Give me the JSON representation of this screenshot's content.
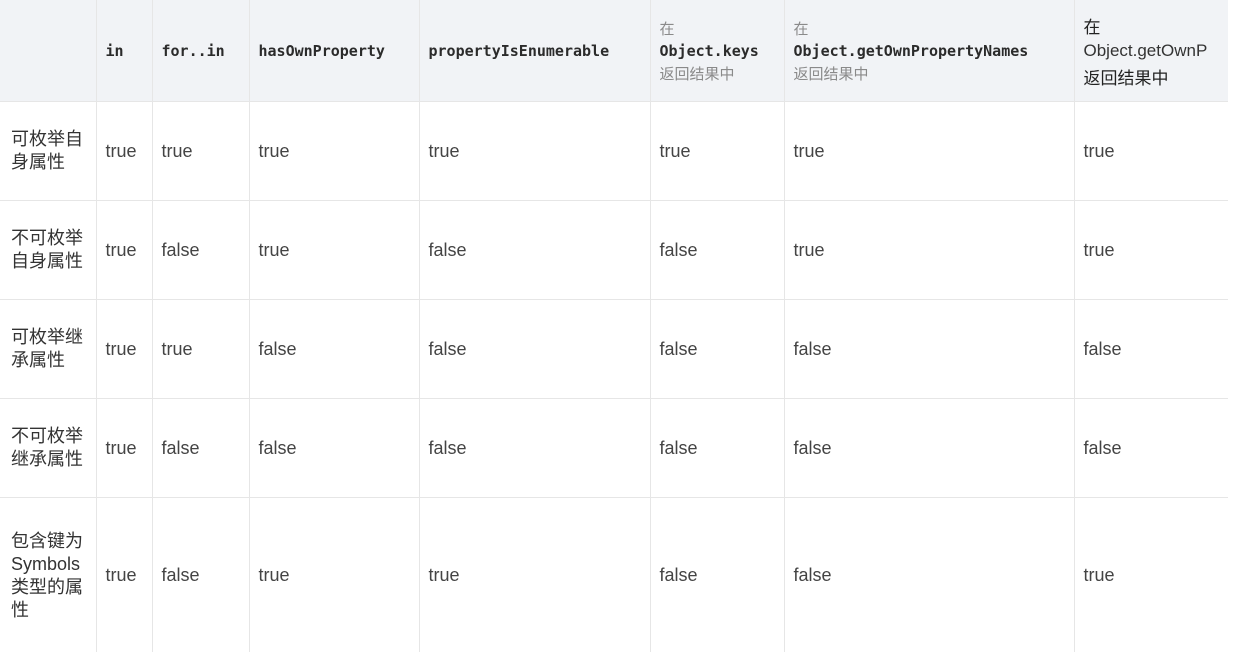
{
  "table": {
    "headers": [
      {
        "kind": "empty",
        "text": ""
      },
      {
        "kind": "code",
        "text": "in"
      },
      {
        "kind": "code",
        "text": "for..in"
      },
      {
        "kind": "code",
        "text": "hasOwnProperty"
      },
      {
        "kind": "code",
        "text": "propertyIsEnumerable"
      },
      {
        "kind": "stack",
        "top": "在",
        "code": "Object.keys",
        "bottom": "返回结果中"
      },
      {
        "kind": "stack",
        "top": "在",
        "code": "Object.getOwnPropertyNames",
        "bottom": "返回结果中"
      },
      {
        "kind": "stack-plain",
        "top": "在",
        "code": "Object.getOwnP",
        "bottom": "返回结果中"
      }
    ],
    "rows": [
      {
        "label": "可枚举自身属性",
        "values": [
          "true",
          "true",
          "true",
          "true",
          "true",
          "true",
          "true"
        ]
      },
      {
        "label": "不可枚举自身属性",
        "values": [
          "true",
          "false",
          "true",
          "false",
          "false",
          "true",
          "true"
        ]
      },
      {
        "label": "可枚举继承属性",
        "values": [
          "true",
          "true",
          "false",
          "false",
          "false",
          "false",
          "false"
        ]
      },
      {
        "label": "不可枚举继承属性",
        "values": [
          "true",
          "false",
          "false",
          "false",
          "false",
          "false",
          "false"
        ]
      },
      {
        "label": "包含键为Symbols 类型的属性",
        "values": [
          "true",
          "false",
          "true",
          "true",
          "false",
          "false",
          "true"
        ]
      }
    ]
  }
}
